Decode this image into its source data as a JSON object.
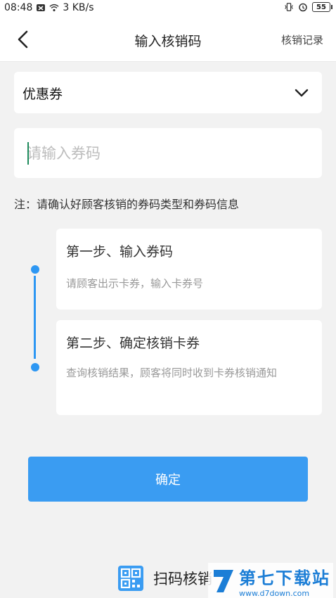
{
  "status_bar": {
    "time": "08:48",
    "network_speed": "3 KB/s",
    "battery": "55",
    "icons": [
      "notification-x-icon",
      "wifi-icon",
      "vibrate-icon",
      "alarm-icon",
      "battery-icon"
    ]
  },
  "nav": {
    "title": "输入核销码",
    "right_label": "核销记录",
    "back_icon": "chevron-left-icon"
  },
  "form": {
    "type_label": "优惠券",
    "type_dropdown_icon": "chevron-down-icon",
    "code_placeholder": "请输入券码",
    "code_value": ""
  },
  "note": "注：请确认好顾客核销的券码类型和券码信息",
  "steps": [
    {
      "title": "第一步、输入券码",
      "desc": "请顾客出示卡券，输入卡券号"
    },
    {
      "title": "第二步、确定核销卡券",
      "desc": "查询核销结果，顾客将同时收到卡券核销通知"
    }
  ],
  "confirm_label": "确定",
  "scan": {
    "label": "扫码核销",
    "icon": "qr-code-icon"
  },
  "watermark": {
    "name": "第七下载站",
    "url": "www.d7down.com"
  },
  "colors": {
    "accent": "#3a9cf2",
    "background": "#f2f2f2",
    "timeline": "#2d97f3"
  }
}
